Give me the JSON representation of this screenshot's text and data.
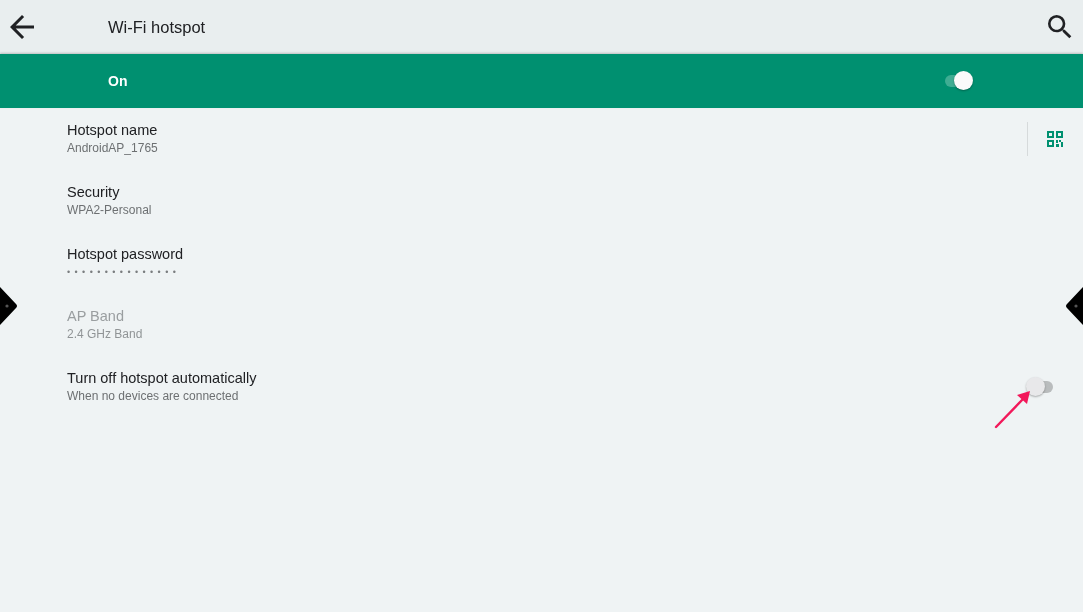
{
  "app_bar": {
    "title": "Wi-Fi hotspot"
  },
  "master_switch": {
    "label": "On",
    "on": true
  },
  "settings": [
    {
      "kind": "qr",
      "title": "Hotspot name",
      "summary": "AndroidAP_1765",
      "disabled": false
    },
    {
      "kind": "text",
      "title": "Security",
      "summary": "WPA2-Personal",
      "disabled": false
    },
    {
      "kind": "password",
      "title": "Hotspot password",
      "summary": "•••••••••••••••",
      "disabled": false
    },
    {
      "kind": "text",
      "title": "AP Band",
      "summary": "2.4 GHz Band",
      "disabled": true
    },
    {
      "kind": "switch",
      "title": "Turn off hotspot automatically",
      "summary": "When no devices are connected",
      "disabled": false,
      "on": false
    }
  ]
}
